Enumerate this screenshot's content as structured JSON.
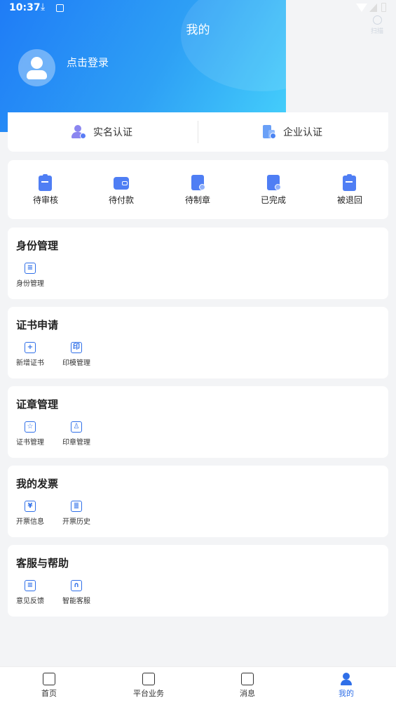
{
  "status_bar": {
    "time": "10:37",
    "download_glyph": "⤓",
    "a_glyph": "A"
  },
  "header": {
    "title": "我的",
    "scan_label": "扫描",
    "login_text": "点击登录"
  },
  "auth": {
    "real_name": "实名认证",
    "enterprise": "企业认证"
  },
  "orders": [
    {
      "label": "待审核",
      "icon": "clipboard-clock-icon"
    },
    {
      "label": "待付款",
      "icon": "wallet-icon"
    },
    {
      "label": "待制章",
      "icon": "document-stamp-icon"
    },
    {
      "label": "已完成",
      "icon": "document-check-icon"
    },
    {
      "label": "被退回",
      "icon": "return-icon"
    }
  ],
  "sections": [
    {
      "title": "身份管理",
      "items": [
        {
          "label": "身份管理",
          "glyph": "≡"
        }
      ]
    },
    {
      "title": "证书申请",
      "items": [
        {
          "label": "新增证书",
          "glyph": "+"
        },
        {
          "label": "印模管理",
          "glyph": "印"
        }
      ]
    },
    {
      "title": "证章管理",
      "items": [
        {
          "label": "证书管理",
          "glyph": "☆"
        },
        {
          "label": "印章管理",
          "glyph": "♙"
        }
      ]
    },
    {
      "title": "我的发票",
      "items": [
        {
          "label": "开票信息",
          "glyph": "¥"
        },
        {
          "label": "开票历史",
          "glyph": "≣"
        }
      ]
    },
    {
      "title": "客服与帮助",
      "items": [
        {
          "label": "意见反馈",
          "glyph": "≡"
        },
        {
          "label": "智能客服",
          "glyph": "∩"
        }
      ]
    }
  ],
  "tabs": [
    "首页",
    "平台业务",
    "消息",
    "我的"
  ],
  "colors": {
    "accent": "#2f6fe8",
    "header_start": "#1f7cf6",
    "header_end": "#45d0fb"
  }
}
